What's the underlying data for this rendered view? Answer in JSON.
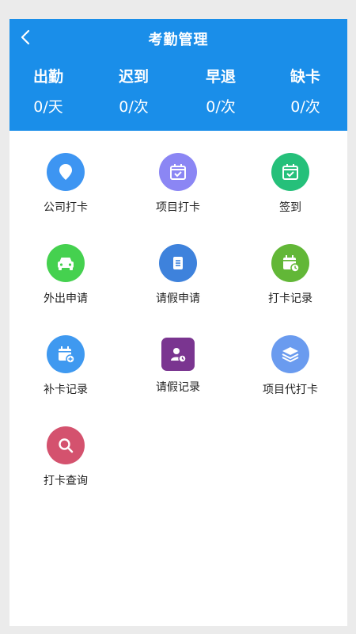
{
  "header": {
    "title": "考勤管理",
    "back_icon": "chevron-left-icon",
    "background": "#1a8ee9"
  },
  "stats": [
    {
      "label": "出勤",
      "value": "0/天"
    },
    {
      "label": "迟到",
      "value": "0/次"
    },
    {
      "label": "早退",
      "value": "0/次"
    },
    {
      "label": "缺卡",
      "value": "0/次"
    }
  ],
  "menu": [
    {
      "label": "公司打卡",
      "icon": "location-pin-icon",
      "color": "#3d95f2"
    },
    {
      "label": "项目打卡",
      "icon": "calendar-check-icon",
      "color": "#8b86f4"
    },
    {
      "label": "签到",
      "icon": "calendar-check-icon",
      "color": "#25c07a"
    },
    {
      "label": "外出申请",
      "icon": "car-icon",
      "color": "#45d14f"
    },
    {
      "label": "请假申请",
      "icon": "document-icon",
      "color": "#3e82dc"
    },
    {
      "label": "打卡记录",
      "icon": "calendar-clock-icon",
      "color": "#62b737"
    },
    {
      "label": "补卡记录",
      "icon": "calendar-add-icon",
      "color": "#3f99f0"
    },
    {
      "label": "请假记录",
      "icon": "user-clock-icon",
      "color": "#7a3590"
    },
    {
      "label": "项目代打卡",
      "icon": "layers-icon",
      "color": "#6a9bef"
    },
    {
      "label": "打卡查询",
      "icon": "search-icon",
      "color": "#d4526e"
    }
  ]
}
